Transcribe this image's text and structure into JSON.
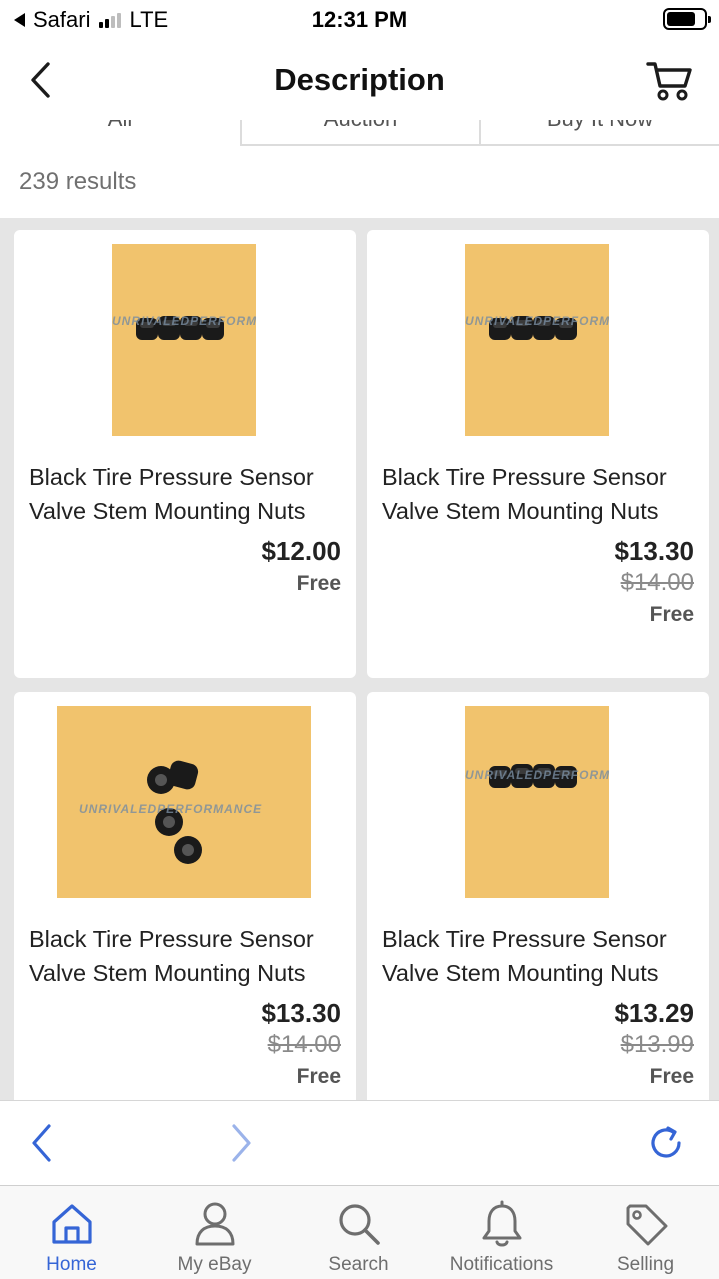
{
  "status_bar": {
    "carrier": "Safari",
    "network": "LTE",
    "time": "12:31 PM"
  },
  "header": {
    "title": "Description"
  },
  "tabs": [
    {
      "label": "All",
      "active": true
    },
    {
      "label": "Auction",
      "active": false
    },
    {
      "label": "Buy It Now",
      "active": false
    }
  ],
  "results_count": "239 results",
  "listings": [
    {
      "title": "Black Tire Pressure Sensor Valve Stem Mounting Nuts",
      "price": "$12.00",
      "original_price": "",
      "shipping": "Free",
      "watermark": "UNRIVALEDPERFORMANCE"
    },
    {
      "title": "Black Tire Pressure Sensor Valve Stem Mounting Nuts",
      "price": "$13.30",
      "original_price": "$14.00",
      "shipping": "Free",
      "watermark": "UNRIVALEDPERFORMANCE"
    },
    {
      "title": "Black Tire Pressure Sensor Valve Stem Mounting Nuts",
      "price": "$13.30",
      "original_price": "$14.00",
      "shipping": "Free",
      "watermark": "UNRIVALEDPERFORMANCE"
    },
    {
      "title": "Black Tire Pressure Sensor Valve Stem Mounting Nuts",
      "price": "$13.29",
      "original_price": "$13.99",
      "shipping": "Free",
      "watermark": "UNRIVALEDPERFORMANCE"
    }
  ],
  "tabbar": [
    {
      "label": "Home",
      "icon": "home-icon",
      "active": true
    },
    {
      "label": "My eBay",
      "icon": "person-icon",
      "active": false
    },
    {
      "label": "Search",
      "icon": "search-icon",
      "active": false
    },
    {
      "label": "Notifications",
      "icon": "bell-icon",
      "active": false
    },
    {
      "label": "Selling",
      "icon": "tag-icon",
      "active": false
    }
  ],
  "colors": {
    "accent": "#3565d6",
    "product_background": "#f1c36d",
    "grid_background": "#e5e5e5"
  }
}
